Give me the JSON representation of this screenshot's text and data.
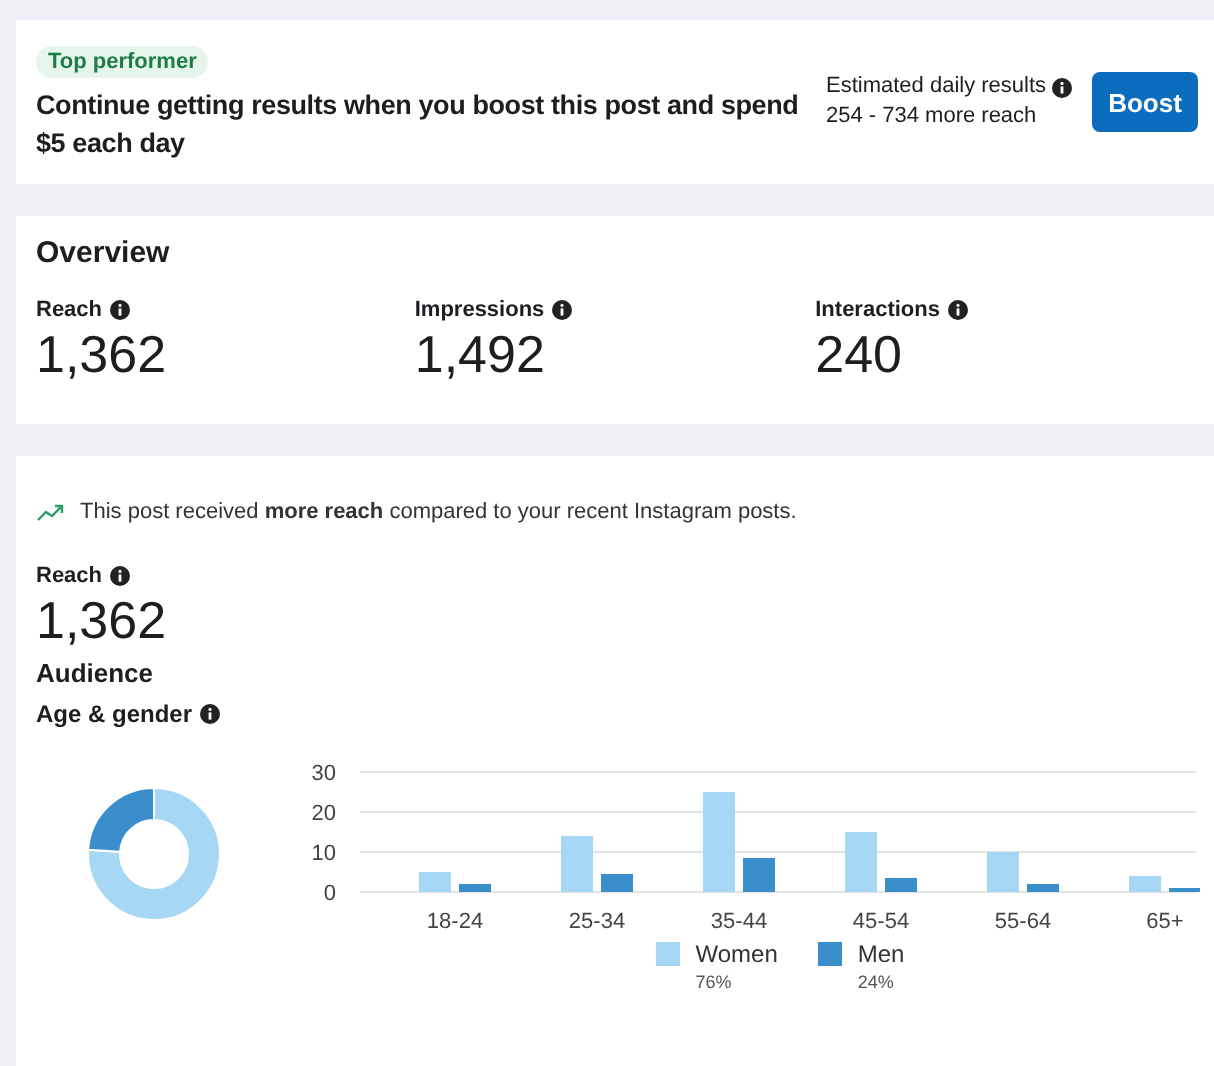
{
  "boost": {
    "badge": "Top performer",
    "message": "Continue getting results when you boost this post and spend $5 each day",
    "estimate_label": "Estimated daily results",
    "estimate_value": "254 - 734 more reach",
    "button": "Boost"
  },
  "overview": {
    "title": "Overview",
    "metrics": [
      {
        "label": "Reach",
        "value": "1,362"
      },
      {
        "label": "Impressions",
        "value": "1,492"
      },
      {
        "label": "Interactions",
        "value": "240"
      }
    ]
  },
  "reach_section": {
    "insight": "This post received **more reach** compared to your recent Instagram posts.",
    "label": "Reach",
    "value": "1,362",
    "audience_title": "Audience",
    "age_gender_label": "Age & gender",
    "donut": {
      "chart_data": {
        "type": "donut",
        "values": [
          76,
          24
        ]
      }
    },
    "bars": {
      "chart_data": {
        "type": "bar",
        "categories": [
          "18-24",
          "25-34",
          "35-44",
          "45-54",
          "55-64",
          "65+"
        ],
        "ylim": [
          0,
          30
        ],
        "yticks": [
          0,
          10,
          20,
          30
        ],
        "series": [
          {
            "name": "Women",
            "color": "#a6d8f5",
            "values": [
              5,
              14,
              25,
              15,
              10,
              4
            ]
          },
          {
            "name": "Men",
            "color": "#3a8ecb",
            "values": [
              2,
              4.5,
              8.5,
              3.5,
              2,
              1
            ]
          }
        ]
      }
    },
    "legend": [
      {
        "percent": "76%"
      },
      {
        "percent": "24%"
      }
    ]
  }
}
